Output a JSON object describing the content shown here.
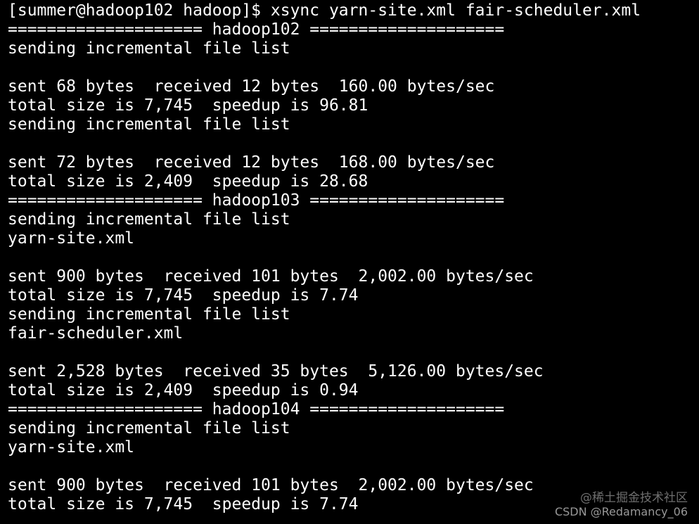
{
  "terminal": {
    "lines": [
      "[summer@hadoop102 hadoop]$ xsync yarn-site.xml fair-scheduler.xml",
      "==================== hadoop102 ====================",
      "sending incremental file list",
      "",
      "sent 68 bytes  received 12 bytes  160.00 bytes/sec",
      "total size is 7,745  speedup is 96.81",
      "sending incremental file list",
      "",
      "sent 72 bytes  received 12 bytes  168.00 bytes/sec",
      "total size is 2,409  speedup is 28.68",
      "==================== hadoop103 ====================",
      "sending incremental file list",
      "yarn-site.xml",
      "",
      "sent 900 bytes  received 101 bytes  2,002.00 bytes/sec",
      "total size is 7,745  speedup is 7.74",
      "sending incremental file list",
      "fair-scheduler.xml",
      "",
      "sent 2,528 bytes  received 35 bytes  5,126.00 bytes/sec",
      "total size is 2,409  speedup is 0.94",
      "==================== hadoop104 ====================",
      "sending incremental file list",
      "yarn-site.xml",
      "",
      "sent 900 bytes  received 101 bytes  2,002.00 bytes/sec",
      "total size is 7,745  speedup is 7.74"
    ]
  },
  "watermark": {
    "line1": "@稀土掘金技术社区",
    "line2": "CSDN @Redamancy_06"
  },
  "colors": {
    "background": "#000000",
    "text": "#ffffff"
  }
}
